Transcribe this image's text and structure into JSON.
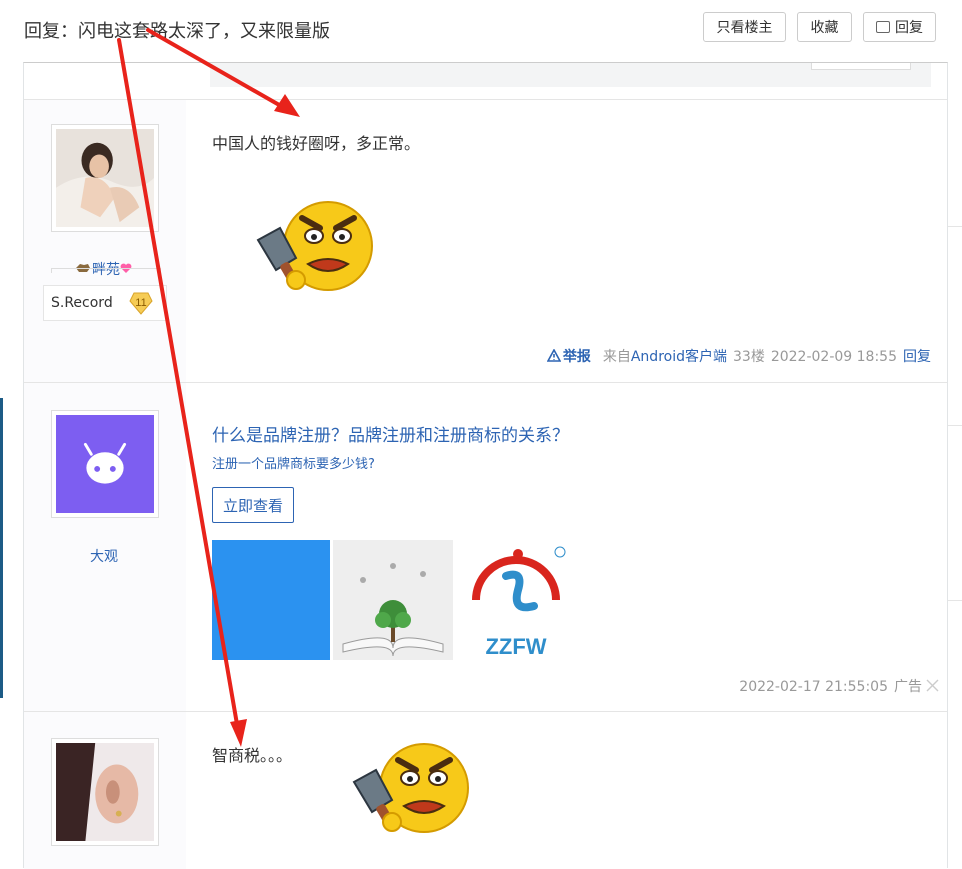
{
  "header": {
    "title": "回复：闪电这套路太深了，又来限量版",
    "btn_louzhu": "只看楼主",
    "btn_fav": "收藏",
    "btn_reply": "回复"
  },
  "posts": [
    {
      "username": "畔苑",
      "content": "中国人的钱好圈呀，多正常。",
      "badge_label": "S.Record",
      "badge_level": "11",
      "report": "举报",
      "from_prefix": "来自",
      "from_client": "Android客户端",
      "floor": "33楼",
      "time": "2022-02-09 18:55",
      "reply": "回复"
    },
    {
      "username": "大观",
      "ad_title": "什么是品牌注册？品牌注册和注册商标的关系？",
      "ad_sub": "注册一个品牌商标要多少钱?",
      "ad_button": "立即查看",
      "ad_logo_text": "ZZFW",
      "time": "2022-02-17 21:55:05",
      "ad_label": "广告"
    },
    {
      "content": "智商税。。。"
    }
  ],
  "colors": {
    "link": "#2d64b3",
    "annotation_arrow": "#e8231b",
    "ad_blue": "#2b92f0",
    "ad_purple": "#7b68ee"
  },
  "icons": [
    "reply-bubble-icon",
    "cleaver-angry-emoji",
    "warning-triangle-icon",
    "close-icon",
    "robot-icon"
  ]
}
